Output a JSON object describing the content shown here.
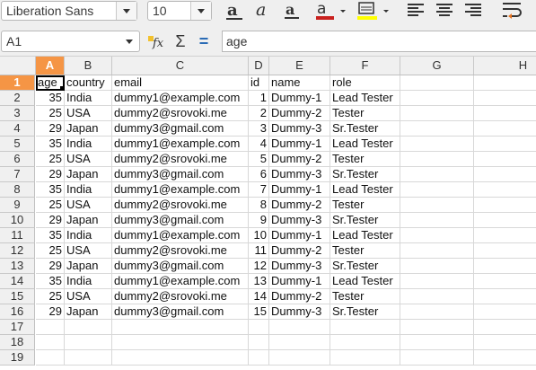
{
  "toolbar": {
    "font_name": "Liberation Sans",
    "font_size": "10",
    "font_color": "#c9211e",
    "highlight_color": "#ffff00",
    "icons": [
      "bold-a-icon",
      "italic-a-icon",
      "underline-a-icon",
      "font-color-icon",
      "highlight-icon",
      "align-left-icon",
      "align-center-icon",
      "align-right-icon",
      "wrap-text-icon"
    ]
  },
  "formula_bar": {
    "name_box": "A1",
    "function_wizard": "fx",
    "sum_symbol": "Σ",
    "equals_symbol": "=",
    "formula": "age"
  },
  "accent": "#f59545",
  "sheet": {
    "columns": [
      "A",
      "B",
      "C",
      "D",
      "E",
      "F",
      "G",
      "H"
    ],
    "selected_column": "A",
    "selected_row": "1",
    "row_numbers": [
      "1",
      "2",
      "3",
      "4",
      "5",
      "6",
      "7",
      "8",
      "9",
      "10",
      "11",
      "12",
      "13",
      "14",
      "15",
      "16",
      "17",
      "18",
      "19"
    ],
    "header_row": [
      "age",
      "country",
      "email",
      "id",
      "name",
      "role"
    ],
    "rows": [
      [
        "35",
        "India",
        "dummy1@example.com",
        "1",
        "Dummy-1",
        "Lead Tester"
      ],
      [
        "25",
        "USA",
        "dummy2@srovoki.me",
        "2",
        "Dummy-2",
        "Tester"
      ],
      [
        "29",
        "Japan",
        "dummy3@gmail.com",
        "3",
        "Dummy-3",
        "Sr.Tester"
      ],
      [
        "35",
        "India",
        "dummy1@example.com",
        "4",
        "Dummy-1",
        "Lead Tester"
      ],
      [
        "25",
        "USA",
        "dummy2@srovoki.me",
        "5",
        "Dummy-2",
        "Tester"
      ],
      [
        "29",
        "Japan",
        "dummy3@gmail.com",
        "6",
        "Dummy-3",
        "Sr.Tester"
      ],
      [
        "35",
        "India",
        "dummy1@example.com",
        "7",
        "Dummy-1",
        "Lead Tester"
      ],
      [
        "25",
        "USA",
        "dummy2@srovoki.me",
        "8",
        "Dummy-2",
        "Tester"
      ],
      [
        "29",
        "Japan",
        "dummy3@gmail.com",
        "9",
        "Dummy-3",
        "Sr.Tester"
      ],
      [
        "35",
        "India",
        "dummy1@example.com",
        "10",
        "Dummy-1",
        "Lead Tester"
      ],
      [
        "25",
        "USA",
        "dummy2@srovoki.me",
        "11",
        "Dummy-2",
        "Tester"
      ],
      [
        "29",
        "Japan",
        "dummy3@gmail.com",
        "12",
        "Dummy-3",
        "Sr.Tester"
      ],
      [
        "35",
        "India",
        "dummy1@example.com",
        "13",
        "Dummy-1",
        "Lead Tester"
      ],
      [
        "25",
        "USA",
        "dummy2@srovoki.me",
        "14",
        "Dummy-2",
        "Tester"
      ],
      [
        "29",
        "Japan",
        "dummy3@gmail.com",
        "15",
        "Dummy-3",
        "Sr.Tester"
      ]
    ]
  }
}
